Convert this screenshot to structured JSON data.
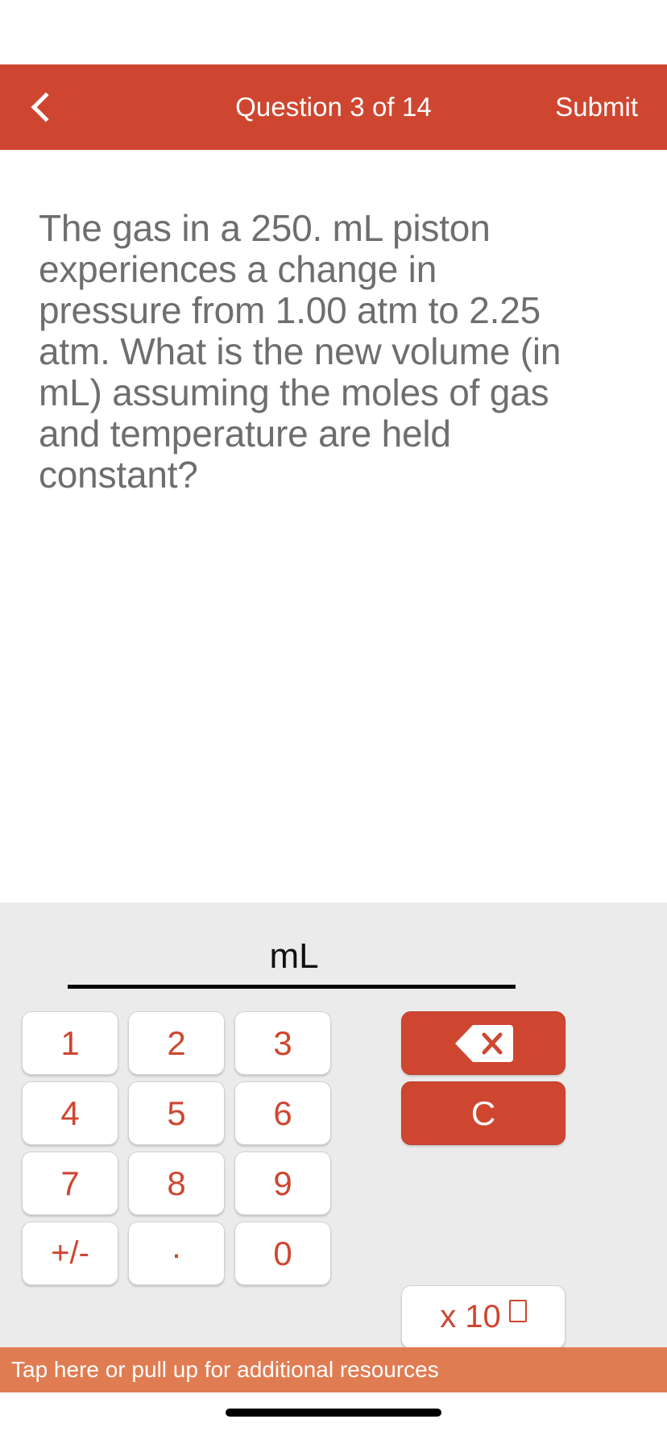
{
  "header": {
    "back_icon": "chevron-left-icon",
    "title": "Question 3 of 14",
    "submit_label": "Submit"
  },
  "question": {
    "text": "The gas in a 250. mL piston experiences a change in pressure from 1.00 atm to 2.25 atm. What is the new volume (in mL) assuming the moles of gas and temperature are held constant?"
  },
  "answer": {
    "value": "",
    "unit": "mL",
    "placeholder": ""
  },
  "keypad": {
    "keys": [
      {
        "label": "1",
        "name": "key-1"
      },
      {
        "label": "2",
        "name": "key-2"
      },
      {
        "label": "3",
        "name": "key-3"
      },
      {
        "label": "4",
        "name": "key-4"
      },
      {
        "label": "5",
        "name": "key-5"
      },
      {
        "label": "6",
        "name": "key-6"
      },
      {
        "label": "7",
        "name": "key-7"
      },
      {
        "label": "8",
        "name": "key-8"
      },
      {
        "label": "9",
        "name": "key-9"
      },
      {
        "label": "+/-",
        "name": "key-plus-minus"
      },
      {
        "label": ".",
        "name": "key-decimal"
      },
      {
        "label": "0",
        "name": "key-0"
      }
    ],
    "backspace_icon": "backspace-delete-icon",
    "clear_label": "C",
    "exponent_label": "x 10"
  },
  "banner": {
    "text": "Tap here or pull up for additional resources"
  },
  "colors": {
    "brand_red": "#cf4630",
    "banner_orange": "#e07c52",
    "keypad_bg": "#ebebeb",
    "question_text": "#6e6e6e"
  }
}
